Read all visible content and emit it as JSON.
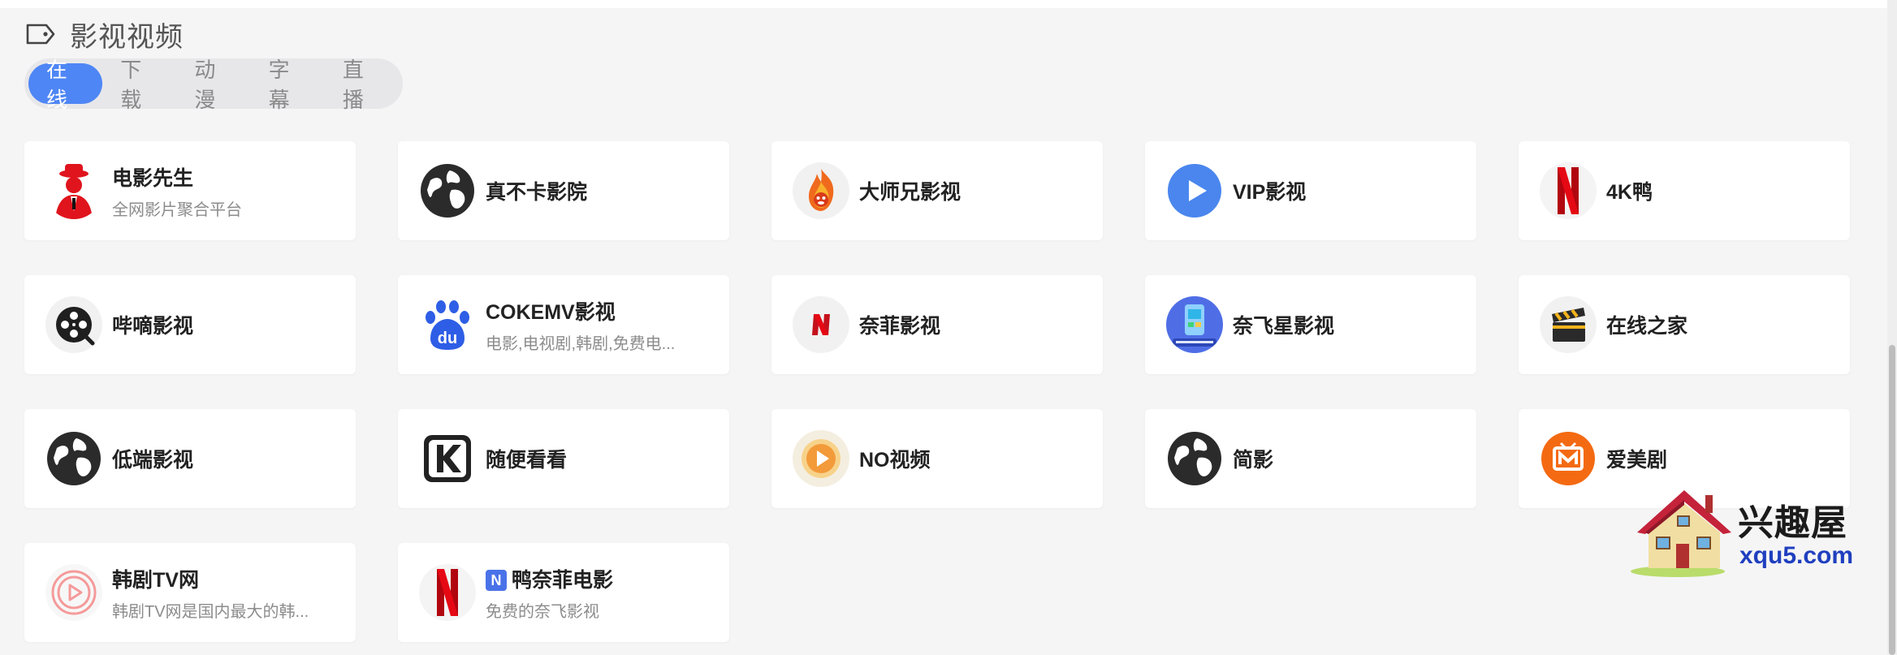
{
  "section": {
    "title": "影视视频"
  },
  "tabs": [
    {
      "label": "在线",
      "active": true
    },
    {
      "label": "下载"
    },
    {
      "label": "动漫"
    },
    {
      "label": "字幕"
    },
    {
      "label": "直播"
    }
  ],
  "cards": [
    {
      "name": "电影先生",
      "desc": "全网影片聚合平台",
      "icon": "red-hat-man-icon"
    },
    {
      "name": "真不卡影院",
      "icon": "globe-icon"
    },
    {
      "name": "大师兄影视",
      "icon": "flame-monkey-icon"
    },
    {
      "name": "VIP影视",
      "icon": "play-circle-icon"
    },
    {
      "name": "4K鸭",
      "icon": "netflix-n-icon"
    },
    {
      "name": "哔嘀影视",
      "icon": "film-reel-icon"
    },
    {
      "name": "COKEMV影视",
      "desc": "电影,电视剧,韩剧,免费电...",
      "icon": "baidu-paw-icon"
    },
    {
      "name": "奈菲影视",
      "icon": "netflix-n-icon"
    },
    {
      "name": "奈飞星影视",
      "icon": "app-avatar-icon"
    },
    {
      "name": "在线之家",
      "icon": "clapperboard-icon"
    },
    {
      "name": "低端影视",
      "icon": "globe-icon"
    },
    {
      "name": "随便看看",
      "icon": "k-logo-icon"
    },
    {
      "name": "NO视频",
      "icon": "play-badge-icon"
    },
    {
      "name": "简影",
      "icon": "globe-icon"
    },
    {
      "name": "爱美剧",
      "icon": "tv-m-icon"
    },
    {
      "name": "韩剧TV网",
      "desc": "韩剧TV网是国内最大的韩...",
      "icon": "play-ring-icon"
    },
    {
      "name": "鸭奈菲电影",
      "badge": "N",
      "desc": "免费的奈飞影视",
      "icon": "netflix-n-icon"
    }
  ],
  "watermark": {
    "text": "兴趣屋",
    "url": "xqu5.com"
  },
  "colors": {
    "accent": "#4e86f5",
    "card": "#ffffff",
    "background": "#f5f5f6"
  }
}
